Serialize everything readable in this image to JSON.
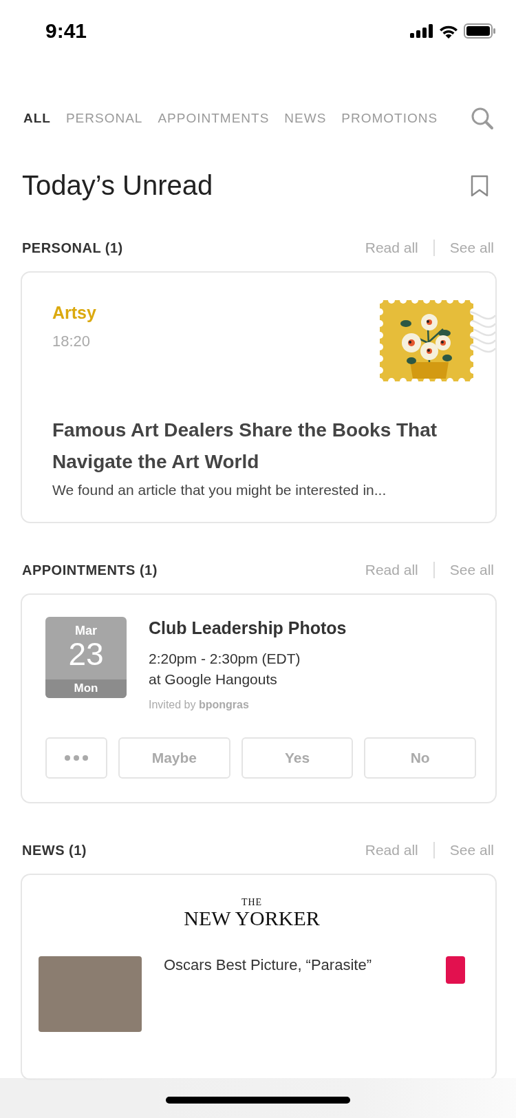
{
  "status_bar": {
    "time": "9:41"
  },
  "tabs": [
    {
      "label": "ALL",
      "selected": true
    },
    {
      "label": "PERSONAL",
      "selected": false
    },
    {
      "label": "APPOINTMENTS",
      "selected": false
    },
    {
      "label": "NEWS",
      "selected": false
    },
    {
      "label": "PROMOTIONS",
      "selected": false
    }
  ],
  "title": "Today’s Unread",
  "sections": [
    {
      "kind": "personal",
      "heading": "PERSONAL (1)",
      "read_all": "Read all",
      "see_all": "See all",
      "sender": "Artsy",
      "time": "18:20",
      "subject": "Famous Art Dealers Share the Books That Navigate the Art World",
      "preview": "We found an article that you might be interested in..."
    },
    {
      "kind": "appointment",
      "heading": "APPOINTMENTS (1)",
      "read_all": "Read all",
      "see_all": "See all",
      "month": "Mar",
      "day": "23",
      "weekday": "Mon",
      "event": "Club Leadership Photos",
      "time": "2:20pm - 2:30pm (EDT)",
      "place": "at Google Hangouts",
      "invite": "Invited by **bpongras**",
      "buttons": [
        "Maybe",
        "Yes",
        "No"
      ]
    },
    {
      "kind": "news",
      "heading": "NEWS (1)",
      "read_all": "Read all",
      "see_all": "See all",
      "logo_small": "THE",
      "logo": "NEW YORKER",
      "headline": "Oscars Best Picture, “Parasite”"
    }
  ]
}
